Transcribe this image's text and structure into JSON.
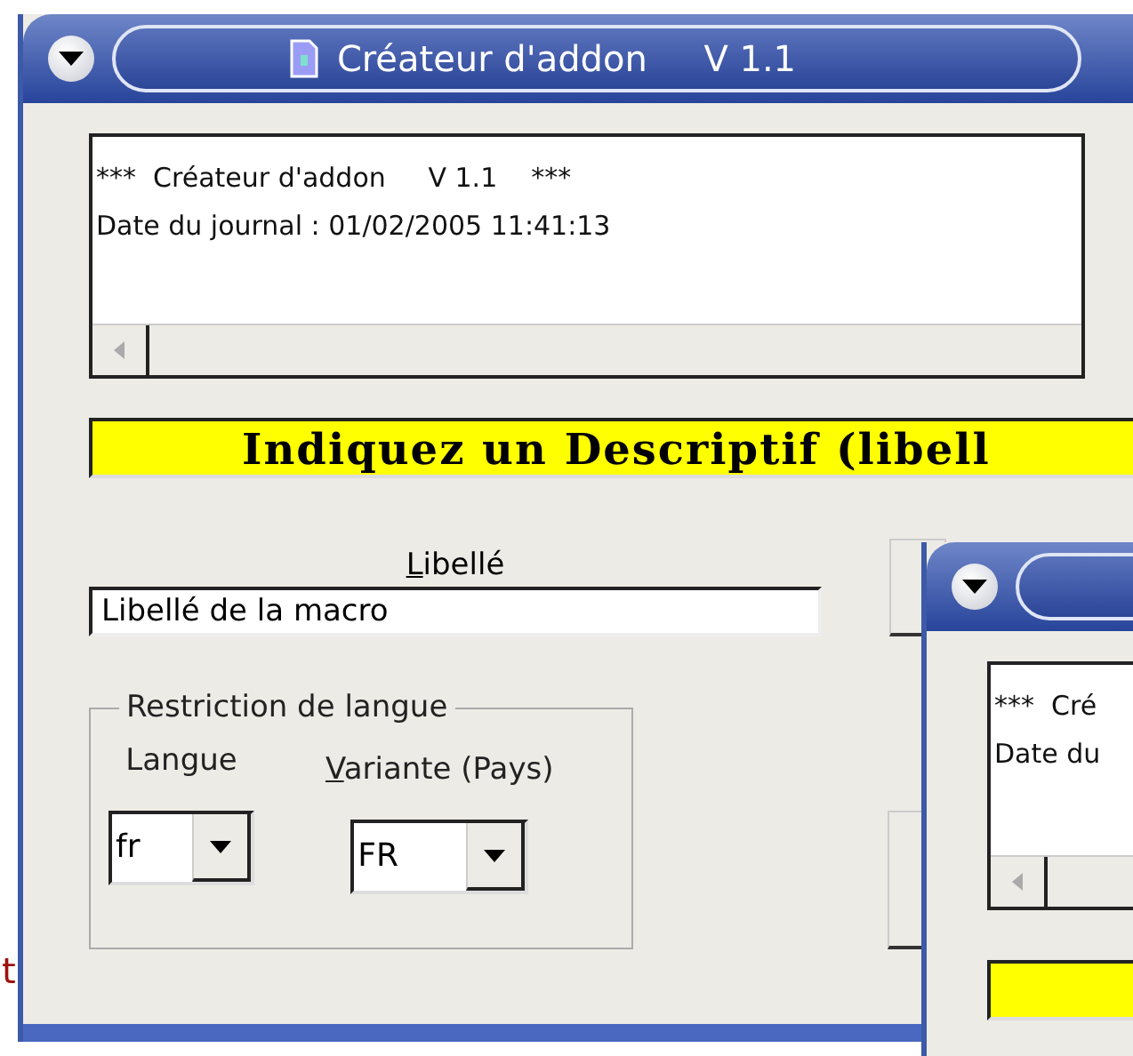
{
  "main_window": {
    "title": "Créateur d'addon     V 1.1",
    "log": [
      "***  Créateur d'addon     V 1.1    ***",
      "Date du journal : 01/02/2005 11:41:13"
    ],
    "banner": "Indiquez un Descriptif (libell",
    "label_field": {
      "mnemonic": "L",
      "rest": "ibellé",
      "value": "Libellé de la macro"
    },
    "group": {
      "title": "Restriction de langue",
      "language": {
        "label": "Langue",
        "value": "fr"
      },
      "variant": {
        "mnemonic": "V",
        "rest": "ariante (Pays)",
        "value": "FR"
      }
    }
  },
  "second_window": {
    "log": [
      "***  Cré",
      "Date du"
    ]
  },
  "background_text": "t"
}
